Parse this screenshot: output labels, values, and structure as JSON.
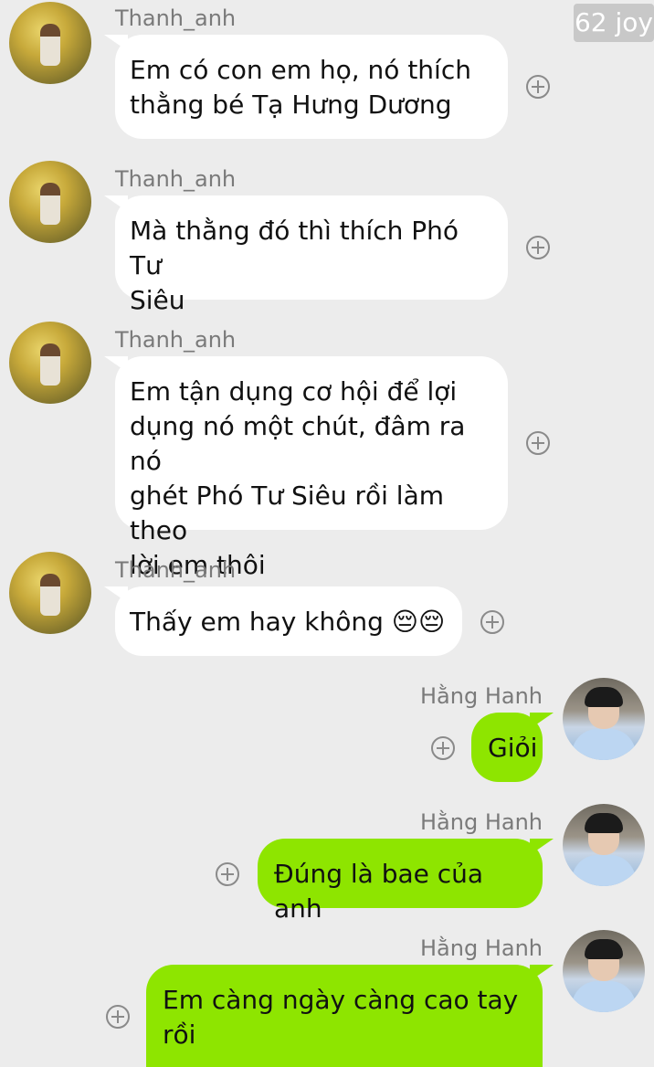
{
  "watermark": "62 joy",
  "colors": {
    "background": "#ececec",
    "incoming_bubble": "#ffffff",
    "outgoing_bubble": "#8ee500",
    "sender_name": "#7a7a7a"
  },
  "messages": [
    {
      "sender": "Thanh_anh",
      "text": "Em có con em họ, nó thích\nthằng bé Tạ Hưng Dương",
      "direction": "incoming",
      "avatar_icon": "profile-photo-flower-field",
      "action_icon": "add-reaction-icon"
    },
    {
      "sender": "Thanh_anh",
      "text": "Mà thằng đó thì thích Phó Tư\nSiêu",
      "direction": "incoming",
      "avatar_icon": "profile-photo-flower-field",
      "action_icon": "add-reaction-icon"
    },
    {
      "sender": "Thanh_anh",
      "text": "Em tận dụng cơ hội để lợi\ndụng nó một chút, đâm ra nó\nghét Phó Tư Siêu rồi làm theo\nlời em thôi",
      "direction": "incoming",
      "avatar_icon": "profile-photo-flower-field",
      "action_icon": "add-reaction-icon"
    },
    {
      "sender": "Thanh_anh",
      "text": "Thấy em hay không 😔😔",
      "direction": "incoming",
      "avatar_icon": "profile-photo-flower-field",
      "action_icon": "add-reaction-icon"
    },
    {
      "sender": "Hằng Hanh",
      "text": "Giỏi",
      "direction": "outgoing",
      "avatar_icon": "profile-photo-boy",
      "action_icon": "add-reaction-icon"
    },
    {
      "sender": "Hằng Hanh",
      "text": "Đúng là bae của anh",
      "direction": "outgoing",
      "avatar_icon": "profile-photo-boy",
      "action_icon": "add-reaction-icon"
    },
    {
      "sender": "Hằng Hanh",
      "text": "Em càng ngày càng cao tay\nrồi",
      "direction": "outgoing",
      "avatar_icon": "profile-photo-boy",
      "action_icon": "add-reaction-icon"
    }
  ]
}
